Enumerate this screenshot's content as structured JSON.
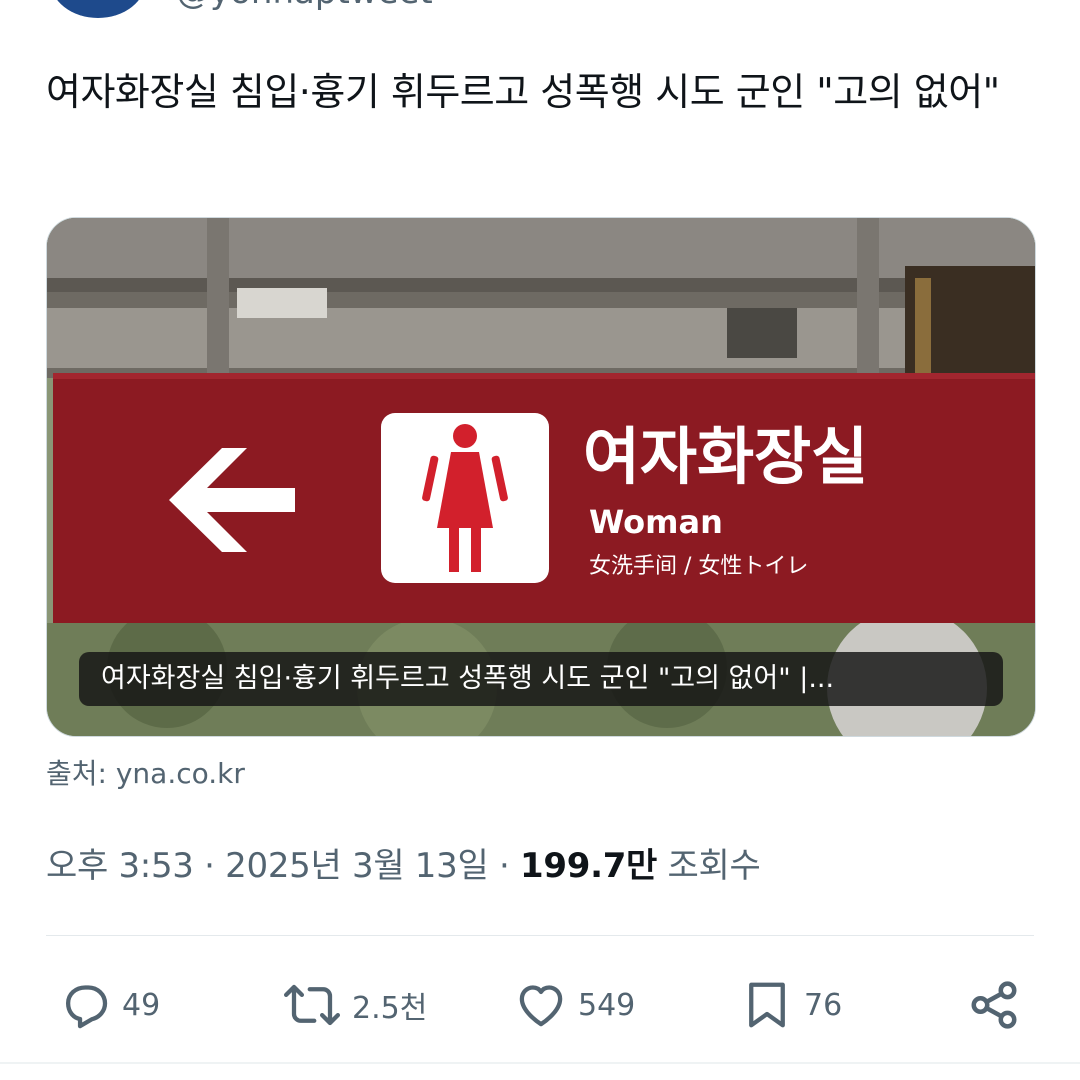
{
  "author": {
    "handle": "@yonhaptweet"
  },
  "tweet": {
    "text": "여자화장실 침입·흉기 휘두르고 성폭행 시도 군인 \"고의 없어\""
  },
  "card": {
    "sign_korean": "여자화장실",
    "sign_english": "Woman",
    "sign_subtitle": "女洗手间 / 女性トイレ",
    "caption": "여자화장실 침입·흉기 휘두르고 성폭행 시도 군인 \"고의 없어\" |..."
  },
  "source": {
    "text": "출처: yna.co.kr"
  },
  "meta": {
    "time": "오후 3:53",
    "separator": "·",
    "date": "2025년 3월 13일",
    "views_count": "199.7만",
    "views_label": "조회수"
  },
  "actions": {
    "replies": "49",
    "retweets": "2.5천",
    "likes": "549",
    "bookmarks": "76"
  },
  "icons": {
    "reply": "reply-icon",
    "retweet": "retweet-icon",
    "like": "heart-icon",
    "bookmark": "bookmark-icon",
    "share": "share-icon"
  },
  "colors": {
    "sign_red": "#8c1a22",
    "text_primary": "#0f1419",
    "text_secondary": "#536471"
  }
}
